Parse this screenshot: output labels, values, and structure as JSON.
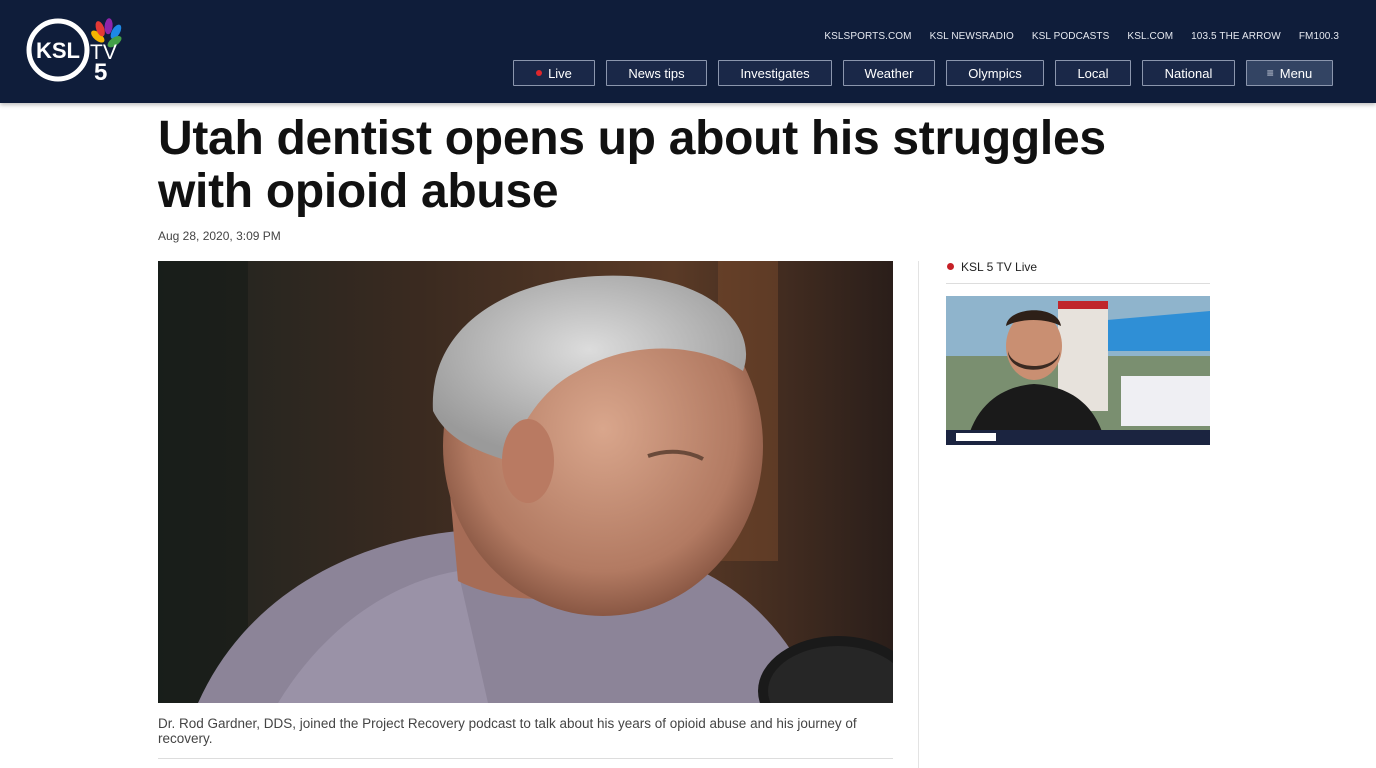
{
  "header": {
    "logo_text": "KSL",
    "logo_tv": "TV",
    "logo_num": "5",
    "top_links": [
      "KSLSPORTS.COM",
      "KSL NEWSRADIO",
      "KSL PODCASTS",
      "KSL.COM",
      "103.5 THE ARROW",
      "FM100.3"
    ],
    "nav": {
      "live": "Live",
      "news_tips": "News tips",
      "investigates": "Investigates",
      "weather": "Weather",
      "olympics": "Olympics",
      "local": "Local",
      "national": "National",
      "menu": "Menu"
    }
  },
  "article": {
    "title": "Utah dentist opens up about his struggles with opioid abuse",
    "date": "Aug 28, 2020, 3:09 PM",
    "caption": "Dr. Rod Gardner, DDS, joined the Project Recovery podcast to talk about his years of opioid abuse and his journey of recovery."
  },
  "sidebar": {
    "live_label": "KSL 5 TV Live"
  },
  "colors": {
    "header_bg": "#0f1d3a",
    "live_red": "#e0262b"
  }
}
